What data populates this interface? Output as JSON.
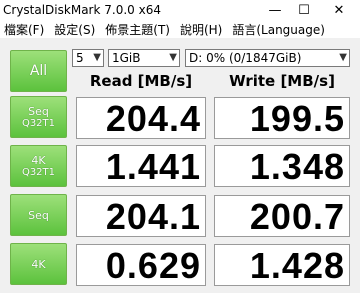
{
  "window": {
    "title": "CrystalDiskMark 7.0.0 x64",
    "minimize_glyph": "—",
    "maximize_glyph": "☐",
    "close_glyph": "✕"
  },
  "menu": {
    "items": [
      "檔案(F)",
      "設定(S)",
      "佈景主題(T)",
      "說明(H)",
      "語言(Language)"
    ]
  },
  "controls": {
    "all_label": "All",
    "count": "5",
    "size": "1GiB",
    "drive": "D: 0% (0/1847GiB)"
  },
  "headers": {
    "read": "Read [MB/s]",
    "write": "Write [MB/s]"
  },
  "rows": [
    {
      "line1": "Seq",
      "line2": "Q32T1",
      "read": "204.4",
      "write": "199.5"
    },
    {
      "line1": "4K",
      "line2": "Q32T1",
      "read": "1.441",
      "write": "1.348"
    },
    {
      "line1": "Seq",
      "line2": "",
      "read": "204.1",
      "write": "200.7"
    },
    {
      "line1": "4K",
      "line2": "",
      "read": "0.629",
      "write": "1.428"
    }
  ],
  "colors": {
    "accent_green": "#5cc23d",
    "bg": "#f0f0f0"
  }
}
